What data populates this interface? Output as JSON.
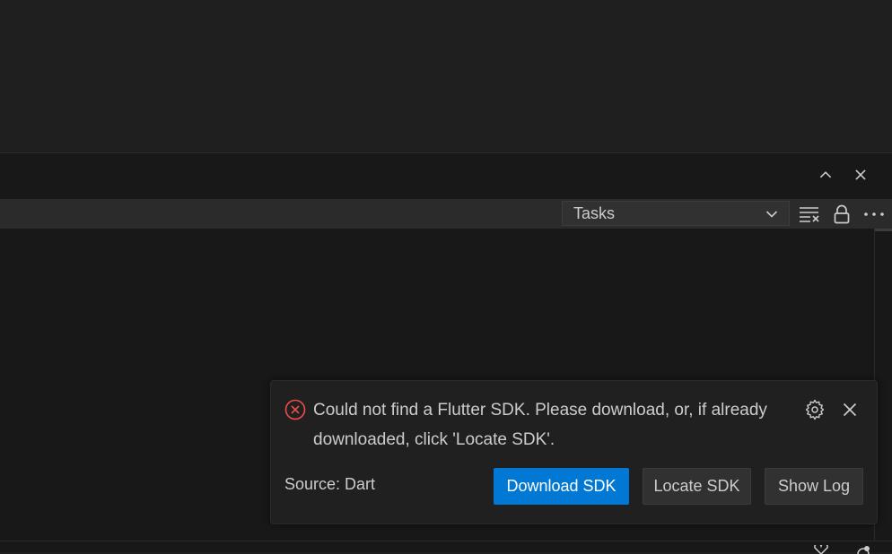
{
  "panel": {
    "toolbar": {
      "task_select_value": "Tasks"
    }
  },
  "notification": {
    "message": "Could not find a Flutter SDK. Please download, or, if already downloaded, click 'Locate SDK'.",
    "source": "Source: Dart",
    "buttons": {
      "download": "Download SDK",
      "locate": "Locate SDK",
      "show_log": "Show Log"
    }
  },
  "colors": {
    "background": "#1f1f1f",
    "panel": "#181818",
    "toolbar": "#2b2b2b",
    "primary_button": "#0078d4",
    "error": "#f14c4c"
  },
  "icons": {
    "panel_title_actions": [
      "chevron-up-icon",
      "close-icon"
    ],
    "panel_toolbar": [
      "clear-output-icon",
      "lock-icon",
      "more-actions-icon"
    ],
    "notification": [
      "error-icon",
      "gear-icon",
      "close-icon"
    ]
  }
}
